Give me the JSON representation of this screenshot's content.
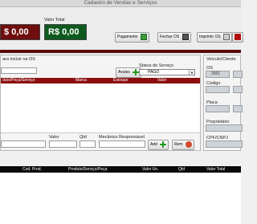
{
  "window": {
    "title": "Cadastro de Vendas e Serviços"
  },
  "summary": {
    "left_value": "$ 0,00",
    "total_label": "Valor Total",
    "total_value": "R$ 0,00"
  },
  "toolbar": {
    "pagamento": "Pagamento",
    "fechar_os": "Fechar OS",
    "imprimir_os": "Imprimir OS"
  },
  "items_panel": {
    "title": "ara incluir na OS",
    "avulso": "Avulso",
    "status_label": "Status do Serviço",
    "status_value": "PAGO",
    "columns": [
      "duto/Peça/Serviço",
      "Marca",
      "Estoque",
      "Valor"
    ]
  },
  "entry": {
    "valor": "Valor",
    "qtd": "Qtd",
    "mecanico": "Mecânico Responsável",
    "add": "Add",
    "rem": "Rem"
  },
  "vehicle": {
    "title": "Veículo/Cliente",
    "os_label": "OS",
    "os_value": "2561",
    "codigo": "Código",
    "placa": "Placa",
    "proprietario": "Proprietário",
    "cpf": "CPF/CNPJ"
  },
  "bottom_table": {
    "columns": [
      "Cod. Prod.",
      "Produto/Serviço/Peça",
      "Valor Un.",
      "Qtd",
      "Valor Total"
    ]
  },
  "colors": {
    "dark_red": "#6e0e0e",
    "green": "#0e5a1e",
    "header_red": "#8c0e0e"
  }
}
